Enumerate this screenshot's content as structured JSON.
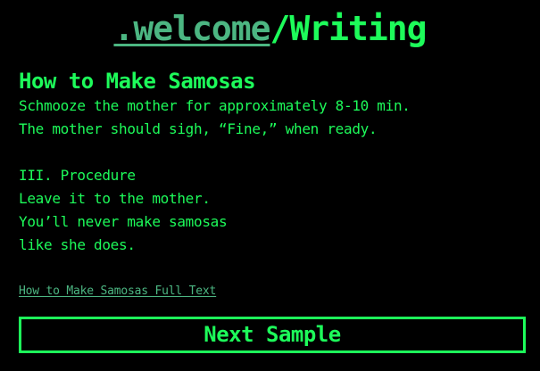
{
  "header": {
    "home_link": ".welcome",
    "separator": "/",
    "section": "Writing"
  },
  "article": {
    "title": "How to Make Samosas",
    "lines": [
      "Schmooze the mother for approximately 8-10 min.",
      "The mother should sigh, “Fine,” when ready.",
      "",
      "III. Procedure",
      "Leave it to the mother.",
      "You’ll never make samosas",
      "like she does."
    ]
  },
  "full_text_link": "How to Make Samosas Full Text",
  "next_button_label": "Next Sample",
  "colors": {
    "background": "#000000",
    "text": "#1dfc5a",
    "link": "#4cb682"
  }
}
